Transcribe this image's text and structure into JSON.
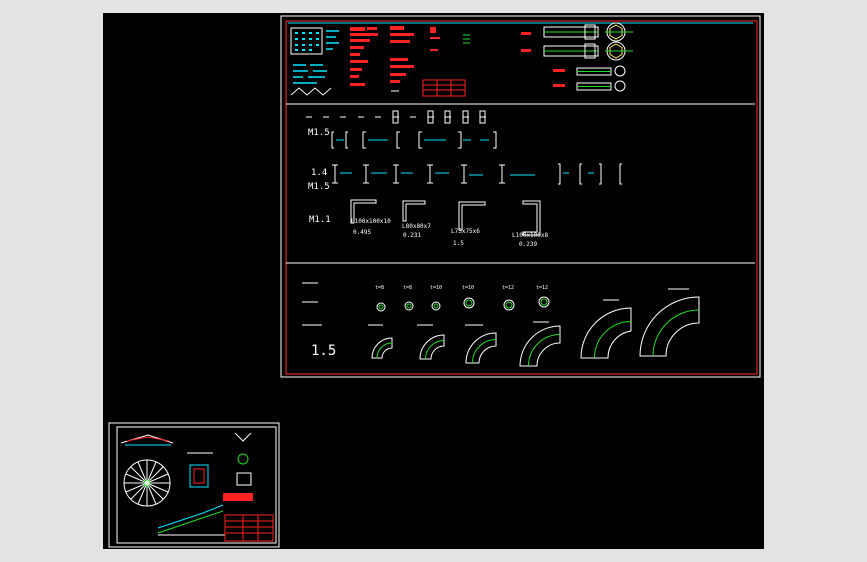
{
  "colors": {
    "background": "#e3e3e3",
    "canvas": "#000000",
    "frame_outer": "#ffffff",
    "frame_inner": "#ff3030",
    "line": "#ffffff",
    "accent_green": "#22dd22",
    "accent_cyan": "#00e5ff",
    "accent_red": "#ff2222",
    "accent_yellow": "#ffee44"
  },
  "drawing": {
    "row_labels": {
      "r1": "M1.5",
      "r2_top": "1.4",
      "r2_bottom": "M1.5",
      "r3": "M1.1",
      "r4": "1.5"
    },
    "angle_captions": [
      {
        "text": "L100x100x10",
        "sub": "0.495"
      },
      {
        "text": "L80x80x7",
        "sub": "0.231"
      },
      {
        "text": "L75x75x6",
        "sub": "1.5"
      },
      {
        "text": "L100x100x8",
        "sub": "0.239"
      }
    ],
    "pipe_tags": [
      "t=8",
      "t=8",
      "t=10",
      "t=10",
      "t=12",
      "t=12"
    ]
  }
}
